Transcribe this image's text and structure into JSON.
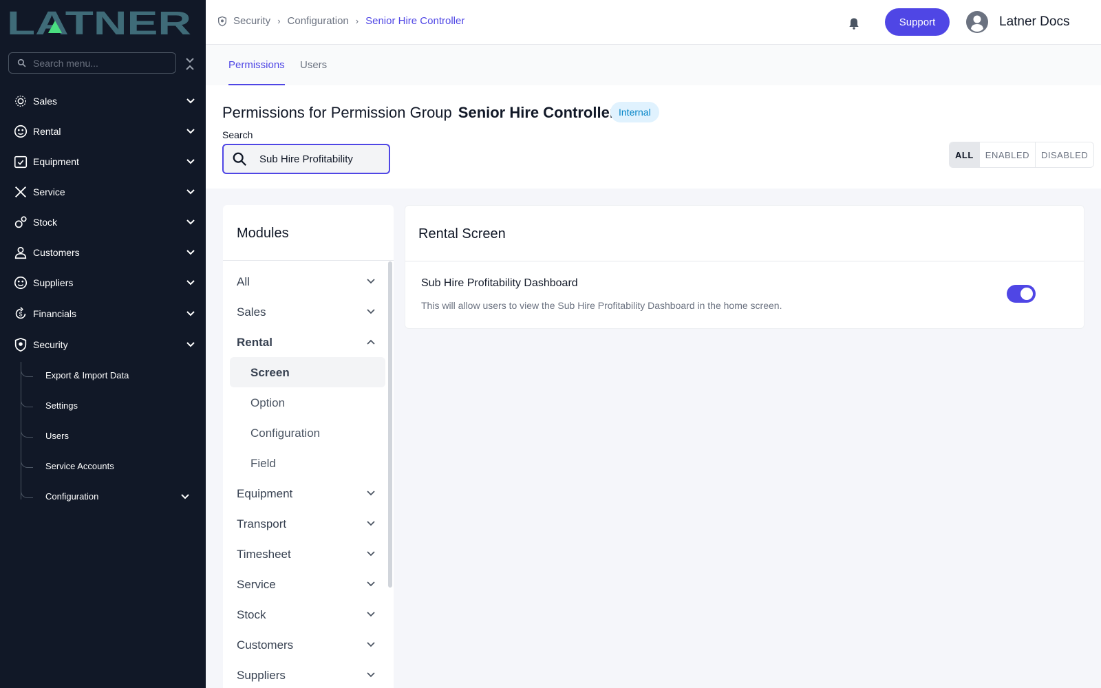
{
  "sidebar": {
    "brand": "LATNER",
    "search_placeholder": "Search menu...",
    "items": [
      {
        "label": "Sales",
        "icon": "sales-icon"
      },
      {
        "label": "Rental",
        "icon": "rental-icon"
      },
      {
        "label": "Equipment",
        "icon": "equipment-icon"
      },
      {
        "label": "Service",
        "icon": "service-icon"
      },
      {
        "label": "Stock",
        "icon": "stock-icon"
      },
      {
        "label": "Customers",
        "icon": "customers-icon"
      },
      {
        "label": "Suppliers",
        "icon": "suppliers-icon"
      },
      {
        "label": "Financials",
        "icon": "financials-icon"
      },
      {
        "label": "Security",
        "icon": "security-icon"
      }
    ],
    "security_sub": [
      {
        "label": "Export & Import Data"
      },
      {
        "label": "Settings"
      },
      {
        "label": "Users"
      },
      {
        "label": "Service Accounts"
      },
      {
        "label": "Configuration"
      }
    ]
  },
  "header": {
    "breadcrumbs": [
      "Security",
      "Configuration",
      "Senior Hire Controller"
    ],
    "support_label": "Support",
    "user_name": "Latner Docs"
  },
  "tabs": [
    {
      "label": "Permissions",
      "active": true
    },
    {
      "label": "Users",
      "active": false
    }
  ],
  "page": {
    "title_prefix": "Permissions for Permission Group",
    "group_name": "Senior Hire Controller",
    "badge": "Internal",
    "search_label": "Search",
    "search_value": "Sub Hire Profitability",
    "filters": [
      {
        "label": "ALL",
        "active": true
      },
      {
        "label": "ENABLED",
        "active": false
      },
      {
        "label": "DISABLED",
        "active": false
      }
    ]
  },
  "modules": {
    "title": "Modules",
    "items": [
      {
        "label": "All"
      },
      {
        "label": "Sales"
      },
      {
        "label": "Rental",
        "expanded": true
      },
      {
        "label": "Screen",
        "selected": true
      },
      {
        "label": "Option"
      },
      {
        "label": "Configuration"
      },
      {
        "label": "Field"
      },
      {
        "label": "Equipment"
      },
      {
        "label": "Transport"
      },
      {
        "label": "Timesheet"
      },
      {
        "label": "Service"
      },
      {
        "label": "Stock"
      },
      {
        "label": "Customers"
      },
      {
        "label": "Suppliers"
      }
    ]
  },
  "detail": {
    "title": "Rental Screen",
    "permission_name": "Sub Hire Profitability Dashboard",
    "permission_desc": "This will allow users to view the Sub Hire Profitability Dashboard in the home screen.",
    "enabled": true
  },
  "colors": {
    "sidebar_bg": "#111827",
    "accent": "#4f46e5",
    "logo": "#3f6b78",
    "logo_accent": "#4ade80",
    "badge_bg": "#e0f2fe",
    "badge_text": "#0284c7"
  }
}
